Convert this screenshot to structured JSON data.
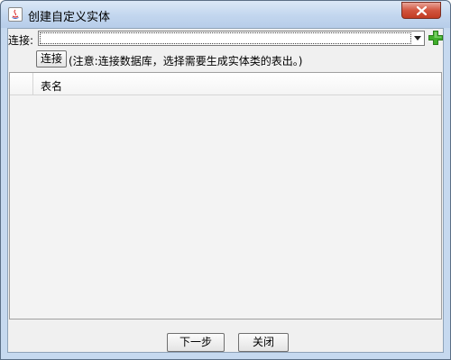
{
  "window": {
    "title": "创建自定义实体",
    "close_icon": "close-icon",
    "app_icon": "java-icon"
  },
  "connection": {
    "label": "连接:",
    "value": "",
    "dropdown_icon": "chevron-down-icon",
    "add_icon": "plus-icon",
    "connect_button": "连接",
    "hint": "(注意:连接数据库，选择需要生成实体类的表出。)"
  },
  "table": {
    "columns": [
      "",
      "表名"
    ],
    "rows": []
  },
  "footer": {
    "next_button": "下一步",
    "close_button": "关闭"
  },
  "colors": {
    "frame": "#c6d9ef",
    "close": "#c23b23",
    "add": "#3fae2a"
  }
}
